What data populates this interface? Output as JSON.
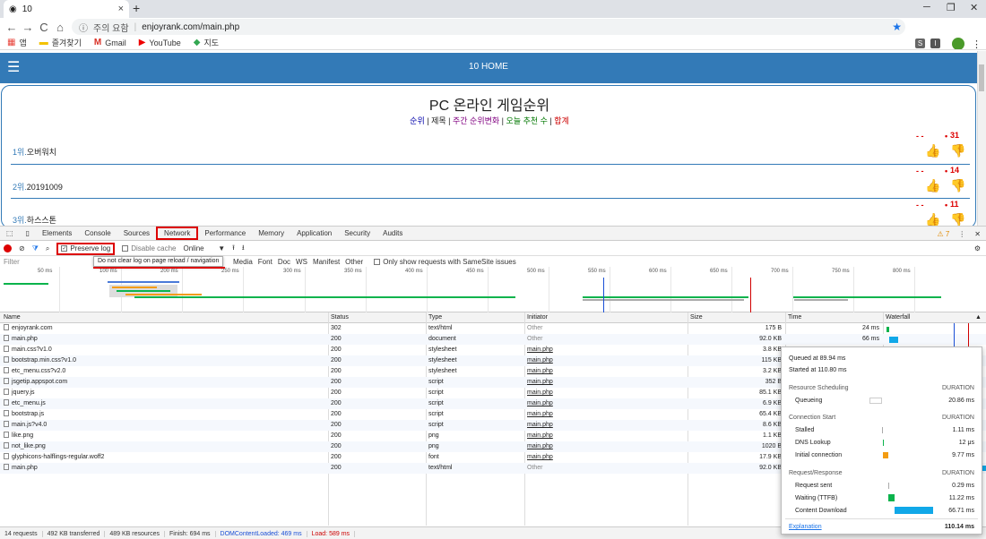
{
  "browser": {
    "tab_title": "10",
    "new_tab": "+",
    "window_min": "─",
    "window_max": "❐",
    "window_close": "✕",
    "nav_back": "←",
    "nav_forward": "→",
    "nav_reload": "C",
    "nav_home": "⌂",
    "security_label": "주의 요함",
    "url": "enjoyrank.com/main.php",
    "menu": "⋮",
    "bookmarks": [
      {
        "icon": "apps-icon",
        "glyph": "▦",
        "label": "앱"
      },
      {
        "icon": "folder-icon",
        "glyph": "▬",
        "label": "즐겨찾기"
      },
      {
        "icon": "gmail-icon",
        "glyph": "M",
        "label": "Gmail"
      },
      {
        "icon": "youtube-icon",
        "glyph": "▶",
        "label": "YouTube"
      },
      {
        "icon": "maps-icon",
        "glyph": "◆",
        "label": "지도"
      }
    ]
  },
  "site": {
    "header_title": "10 HOME",
    "hamburger": "☰",
    "page_title": "PC 온라인 게임순위",
    "nav": [
      "순위",
      "제목",
      "주간 순위변화",
      "오늘 추천 수",
      "합계"
    ],
    "nav_sep": " | ",
    "rankings": [
      {
        "rank": "1위.",
        "name": "오버워치",
        "vote": "31"
      },
      {
        "rank": "2위.",
        "name": "20191009",
        "vote": "14"
      },
      {
        "rank": "3위.",
        "name": "하스스톤",
        "vote": "11"
      }
    ],
    "vote_dash": "- -",
    "vote_dot": "•",
    "thumb_up": "👍",
    "thumb_down": "👎"
  },
  "devtools": {
    "tabs": [
      "Elements",
      "Console",
      "Sources",
      "Network",
      "Performance",
      "Memory",
      "Application",
      "Security",
      "Audits"
    ],
    "selected_tab": "Network",
    "warning_count": "7",
    "menu": "⋮",
    "close": "✕",
    "toolbar": {
      "preserve_log": "Preserve log",
      "disable_cache": "Disable cache",
      "throttle": "Online",
      "throttle_arrow": "▼",
      "import": "⭱",
      "export": "⭳",
      "settings": "⚙"
    },
    "filter": {
      "placeholder": "Filter",
      "types": [
        "Media",
        "Font",
        "Doc",
        "WS",
        "Manifest",
        "Other"
      ],
      "samesite": "Only show requests with SameSite issues"
    },
    "tooltip": "Do not clear log on page reload / navigation",
    "overview_ticks": [
      "50 ms",
      "100 ms",
      "200 ms",
      "250 ms",
      "300 ms",
      "350 ms",
      "400 ms",
      "450 ms",
      "500 ms",
      "550 ms",
      "600 ms",
      "650 ms",
      "700 ms",
      "750 ms",
      "800 ms"
    ],
    "columns": [
      "Name",
      "Status",
      "Type",
      "Initiator",
      "Size",
      "Time",
      "Waterfall"
    ],
    "sort_arrow": "▲",
    "requests": [
      {
        "name": "enjoyrank.com",
        "status": "302",
        "type": "text/html",
        "initiator": "Other",
        "size": "175 B",
        "time": "24 ms"
      },
      {
        "name": "main.php",
        "status": "200",
        "type": "document",
        "initiator": "Other",
        "size": "92.0 KB",
        "time": "66 ms"
      },
      {
        "name": "main.css?v1.0",
        "status": "200",
        "type": "stylesheet",
        "initiator": "main.php",
        "size": "3.8 KB",
        "time": ""
      },
      {
        "name": "bootstrap.min.css?v1.0",
        "status": "200",
        "type": "stylesheet",
        "initiator": "main.php",
        "size": "115 KB",
        "time": ""
      },
      {
        "name": "etc_menu.css?v2.0",
        "status": "200",
        "type": "stylesheet",
        "initiator": "main.php",
        "size": "3.2 KB",
        "time": ""
      },
      {
        "name": "jsgetip.appspot.com",
        "status": "200",
        "type": "script",
        "initiator": "main.php",
        "size": "352 B",
        "time": ""
      },
      {
        "name": "jquery.js",
        "status": "200",
        "type": "script",
        "initiator": "main.php",
        "size": "85.1 KB",
        "time": ""
      },
      {
        "name": "etc_menu.js",
        "status": "200",
        "type": "script",
        "initiator": "main.php",
        "size": "6.9 KB",
        "time": ""
      },
      {
        "name": "bootstrap.js",
        "status": "200",
        "type": "script",
        "initiator": "main.php",
        "size": "65.4 KB",
        "time": ""
      },
      {
        "name": "main.js?v4.0",
        "status": "200",
        "type": "script",
        "initiator": "main.php",
        "size": "8.6 KB",
        "time": ""
      },
      {
        "name": "like.png",
        "status": "200",
        "type": "png",
        "initiator": "main.php",
        "size": "1.1 KB",
        "time": ""
      },
      {
        "name": "not_like.png",
        "status": "200",
        "type": "png",
        "initiator": "main.php",
        "size": "1020 B",
        "time": ""
      },
      {
        "name": "glyphicons-halflings-regular.woff2",
        "status": "200",
        "type": "font",
        "initiator": "main.php",
        "size": "17.9 KB",
        "time": ""
      },
      {
        "name": "main.php",
        "status": "200",
        "type": "text/html",
        "initiator": "Other",
        "size": "92.0 KB",
        "time": ""
      }
    ],
    "status_bar": {
      "requests": "14 requests",
      "transferred": "492 KB transferred",
      "resources": "489 KB resources",
      "finish": "Finish: 694 ms",
      "dcl": "DOMContentLoaded: 469 ms",
      "load": "Load: 589 ms"
    },
    "timing": {
      "queued": "Queued at 89.94 ms",
      "started": "Started at 110.80 ms",
      "duration_label": "DURATION",
      "sections": [
        {
          "title": "Resource Scheduling",
          "items": [
            {
              "label": "Queueing",
              "value": "20.86 ms"
            }
          ]
        },
        {
          "title": "Connection Start",
          "items": [
            {
              "label": "Stalled",
              "value": "1.11 ms"
            },
            {
              "label": "DNS Lookup",
              "value": "12 μs"
            },
            {
              "label": "Initial connection",
              "value": "9.77 ms"
            }
          ]
        },
        {
          "title": "Request/Response",
          "items": [
            {
              "label": "Request sent",
              "value": "0.29 ms"
            },
            {
              "label": "Waiting (TTFB)",
              "value": "11.22 ms"
            },
            {
              "label": "Content Download",
              "value": "66.71 ms"
            }
          ]
        }
      ],
      "explanation": "Explanation",
      "total": "110.14 ms"
    }
  },
  "colors": {
    "brand_blue": "#337ab7",
    "highlight_red": "#dd0000",
    "waterfall_waiting": "#0bb34c",
    "waterfall_download": "#11a8e8",
    "waterfall_connect": "#f39c12",
    "dcl_line": "#1a4fd6",
    "load_line": "#d00000"
  }
}
